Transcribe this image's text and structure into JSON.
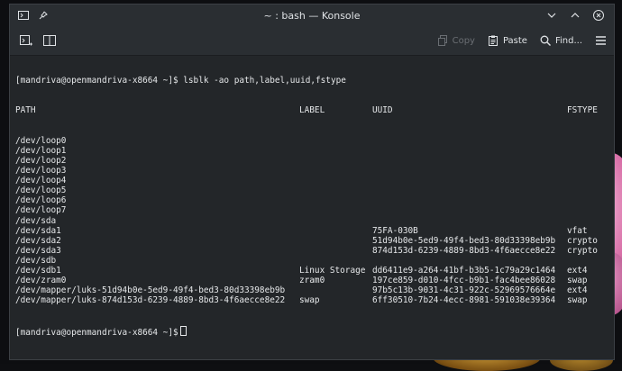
{
  "window": {
    "title": "~ : bash — Konsole"
  },
  "toolbar": {
    "copy_label": "Copy",
    "paste_label": "Paste",
    "find_label": "Find..."
  },
  "terminal": {
    "command_line": "[mandriva@openmandriva-x8664 ~]$ lsblk -ao path,label,uuid,fstype",
    "headers": {
      "path": "PATH",
      "label": "LABEL",
      "uuid": "UUID",
      "fstype": "FSTYPE"
    },
    "rows": [
      {
        "path": "/dev/loop0",
        "label": "",
        "uuid": "",
        "fstype": ""
      },
      {
        "path": "/dev/loop1",
        "label": "",
        "uuid": "",
        "fstype": ""
      },
      {
        "path": "/dev/loop2",
        "label": "",
        "uuid": "",
        "fstype": ""
      },
      {
        "path": "/dev/loop3",
        "label": "",
        "uuid": "",
        "fstype": ""
      },
      {
        "path": "/dev/loop4",
        "label": "",
        "uuid": "",
        "fstype": ""
      },
      {
        "path": "/dev/loop5",
        "label": "",
        "uuid": "",
        "fstype": ""
      },
      {
        "path": "/dev/loop6",
        "label": "",
        "uuid": "",
        "fstype": ""
      },
      {
        "path": "/dev/loop7",
        "label": "",
        "uuid": "",
        "fstype": ""
      },
      {
        "path": "/dev/sda",
        "label": "",
        "uuid": "",
        "fstype": ""
      },
      {
        "path": "/dev/sda1",
        "label": "",
        "uuid": "75FA-030B",
        "fstype": "vfat"
      },
      {
        "path": "/dev/sda2",
        "label": "",
        "uuid": "51d94b0e-5ed9-49f4-bed3-80d33398eb9b",
        "fstype": "crypto"
      },
      {
        "path": "/dev/sda3",
        "label": "",
        "uuid": "874d153d-6239-4889-8bd3-4f6aecce8e22",
        "fstype": "crypto"
      },
      {
        "path": "/dev/sdb",
        "label": "",
        "uuid": "",
        "fstype": ""
      },
      {
        "path": "/dev/sdb1",
        "label": "Linux Storage",
        "uuid": "dd6411e9-a264-41bf-b3b5-1c79a29c1464",
        "fstype": "ext4"
      },
      {
        "path": "/dev/zram0",
        "label": "zram0",
        "uuid": "197ce859-d010-4fcc-b9b1-fac4bee86028",
        "fstype": "swap"
      },
      {
        "path": "/dev/mapper/luks-51d94b0e-5ed9-49f4-bed3-80d33398eb9b",
        "label": "",
        "uuid": "97b5c13b-9031-4c31-922c-52969576664e",
        "fstype": "ext4"
      },
      {
        "path": "/dev/mapper/luks-874d153d-6239-4889-8bd3-4f6aecce8e22",
        "label": "swap",
        "uuid": "6ff30510-7b24-4ecc-8981-591038e39364",
        "fstype": "swap"
      }
    ],
    "prompt": "[mandriva@openmandriva-x8664 ~]$"
  }
}
